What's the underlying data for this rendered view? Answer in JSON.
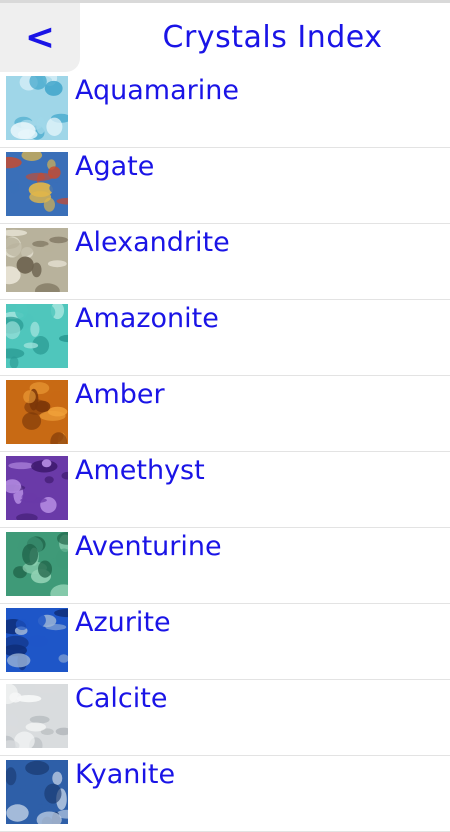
{
  "header": {
    "back_label": "<",
    "title": "Crystals Index"
  },
  "crystals": [
    {
      "name": "Aquamarine",
      "icon": "aquamarine-image",
      "colors": [
        "#9fd6e8",
        "#3aa3c9",
        "#e7f6fb"
      ]
    },
    {
      "name": "Agate",
      "icon": "agate-image",
      "colors": [
        "#3a6fb8",
        "#c94a2e",
        "#e0b64a"
      ]
    },
    {
      "name": "Alexandrite",
      "icon": "alexandrite-image",
      "colors": [
        "#b8b29c",
        "#6e6450",
        "#e8e4d6"
      ]
    },
    {
      "name": "Amazonite",
      "icon": "amazonite-image",
      "colors": [
        "#4fc6bc",
        "#2a9a93",
        "#9fe3dc"
      ]
    },
    {
      "name": "Amber",
      "icon": "amber-image",
      "colors": [
        "#c86a14",
        "#7a3608",
        "#f0a13a"
      ]
    },
    {
      "name": "Amethyst",
      "icon": "amethyst-image",
      "colors": [
        "#6a3aa8",
        "#3e1a6e",
        "#b28ae0"
      ]
    },
    {
      "name": "Aventurine",
      "icon": "aventurine-image",
      "colors": [
        "#3f9a78",
        "#1f6248",
        "#8fd0b2"
      ]
    },
    {
      "name": "Azurite",
      "icon": "azurite-image",
      "colors": [
        "#1e56c8",
        "#0f2f7a",
        "#9ab3d6"
      ]
    },
    {
      "name": "Calcite",
      "icon": "calcite-image",
      "colors": [
        "#d9dcde",
        "#b3b8bc",
        "#f6f7f7"
      ]
    },
    {
      "name": "Kyanite",
      "icon": "kyanite-image",
      "colors": [
        "#2e5fa8",
        "#c7d5e8",
        "#1a3a70"
      ]
    }
  ]
}
